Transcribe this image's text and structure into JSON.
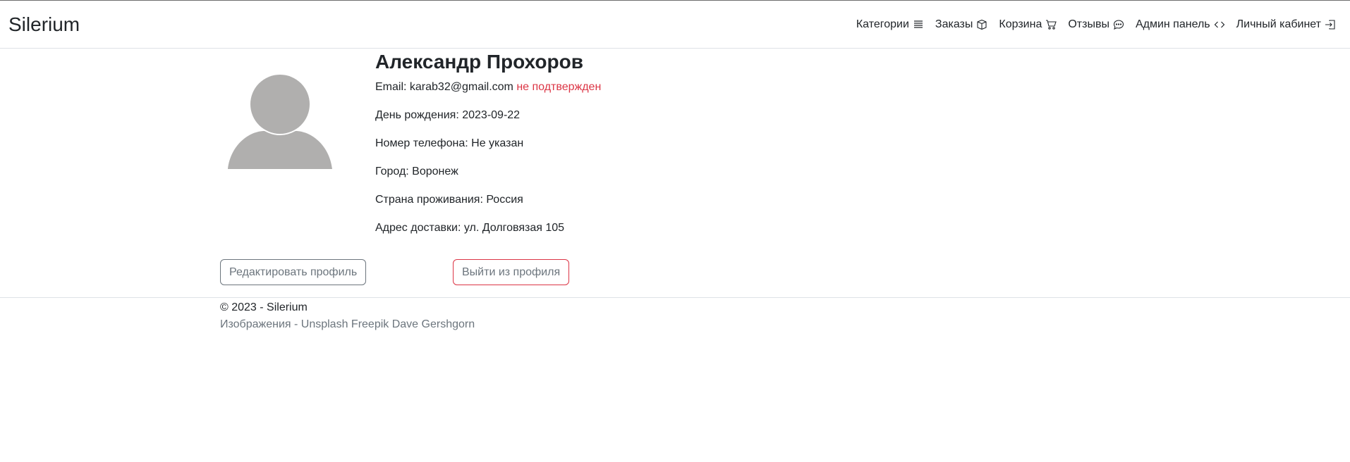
{
  "navbar": {
    "brand": "Silerium",
    "items": [
      {
        "label": "Категории",
        "icon": "list-icon"
      },
      {
        "label": "Заказы",
        "icon": "box-icon"
      },
      {
        "label": "Корзина",
        "icon": "cart-icon"
      },
      {
        "label": "Отзывы",
        "icon": "chat-dots-icon"
      },
      {
        "label": "Админ панель",
        "icon": "code-icon"
      },
      {
        "label": "Личный кабинет",
        "icon": "box-arrow-in-right-icon"
      }
    ]
  },
  "profile": {
    "name": "Александр Прохоров",
    "email_label": "Email:",
    "email": "karab32@gmail.com",
    "email_status": "не подтвержден",
    "birthday": "День рождения: 2023-09-22",
    "phone": "Номер телефона: Не указан",
    "city": "Город: Воронеж",
    "country": "Страна проживания: Россия",
    "address": "Адрес доставки: ул. Долговязая 105"
  },
  "actions": {
    "edit_label": "Редактировать профиль",
    "logout_label": "Выйти из профиля"
  },
  "footer": {
    "copyright": "© 2023 - Silerium",
    "credits": "Изображения - Unsplash Freepik Dave Gershgorn"
  },
  "colors": {
    "warning": "#dc3545",
    "muted": "#6c757d",
    "avatar": "#b0afae"
  }
}
